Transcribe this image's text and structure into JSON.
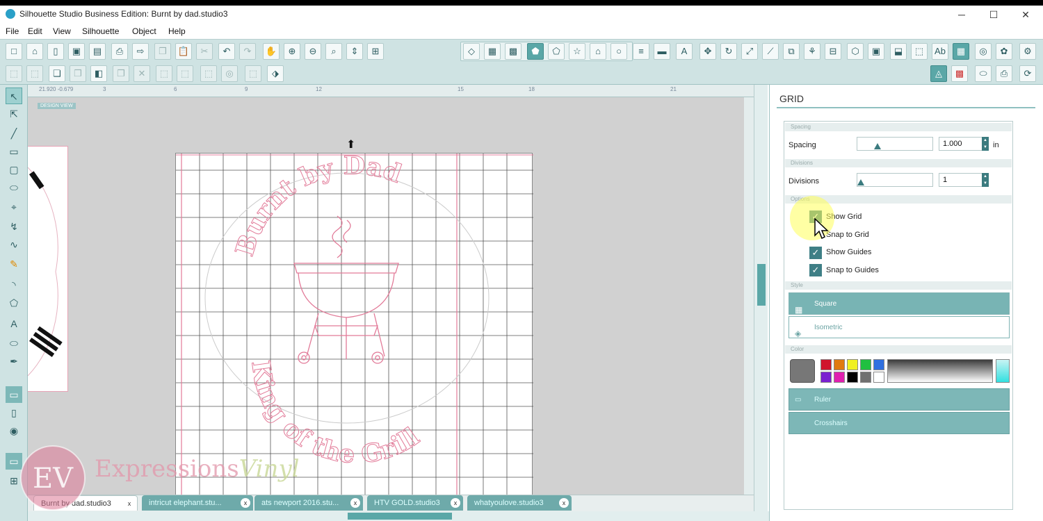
{
  "window": {
    "title": "Silhouette Studio Business Edition: Burnt by dad.studio3",
    "minimize": "─",
    "maximize": "☐",
    "close": "✕"
  },
  "menu": [
    "File",
    "Edit",
    "View",
    "Silhouette",
    "Object",
    "Help"
  ],
  "canvas": {
    "design_view_label": "DESIGN VIEW",
    "ruler_ticks": [
      "3",
      "6",
      "9",
      "12",
      "15",
      "18",
      "21"
    ],
    "coords": "21.920  -0.679"
  },
  "grid_panel": {
    "title": "GRID",
    "spacing_section": "Spacing",
    "spacing_label": "Spacing",
    "spacing_value": "1.000",
    "spacing_unit": "in",
    "divisions_section": "Divisions",
    "divisions_label": "Divisions",
    "divisions_value": "1",
    "options_section": "Options",
    "options": [
      {
        "label": "Show Grid",
        "checked": true
      },
      {
        "label": "Snap to Grid",
        "checked": false
      },
      {
        "label": "Show Guides",
        "checked": true
      },
      {
        "label": "Snap to Guides",
        "checked": true
      }
    ],
    "style_section": "Style",
    "style_square": "Square",
    "style_isometric": "Isometric",
    "color_section": "Color",
    "swatches": [
      "#d0142c",
      "#e07a10",
      "#f0f020",
      "#20c040",
      "#3070e0",
      "#7a20d0",
      "#e020b0",
      "#000000",
      "#707070",
      "#ffffff"
    ],
    "ruler_label": "Ruler",
    "crosshairs_label": "Crosshairs"
  },
  "design": {
    "top_text": "Burnt by Dad",
    "bottom_text": "King of the Grill"
  },
  "tabs": [
    {
      "label": "Burnt by dad.studio3",
      "active": true
    },
    {
      "label": "intricut elephant.stu...",
      "active": false
    },
    {
      "label": "ats newport 2016.stu...",
      "active": false
    },
    {
      "label": "HTV GOLD.studio3",
      "active": false
    },
    {
      "label": "whatyoulove.studio3",
      "active": false
    }
  ],
  "watermark": {
    "initials": "EV",
    "brand_a": "Expressions",
    "brand_b": "Vinyl"
  },
  "colors": {
    "accent": "#5aa7a7",
    "cut_line": "#e27a98"
  }
}
